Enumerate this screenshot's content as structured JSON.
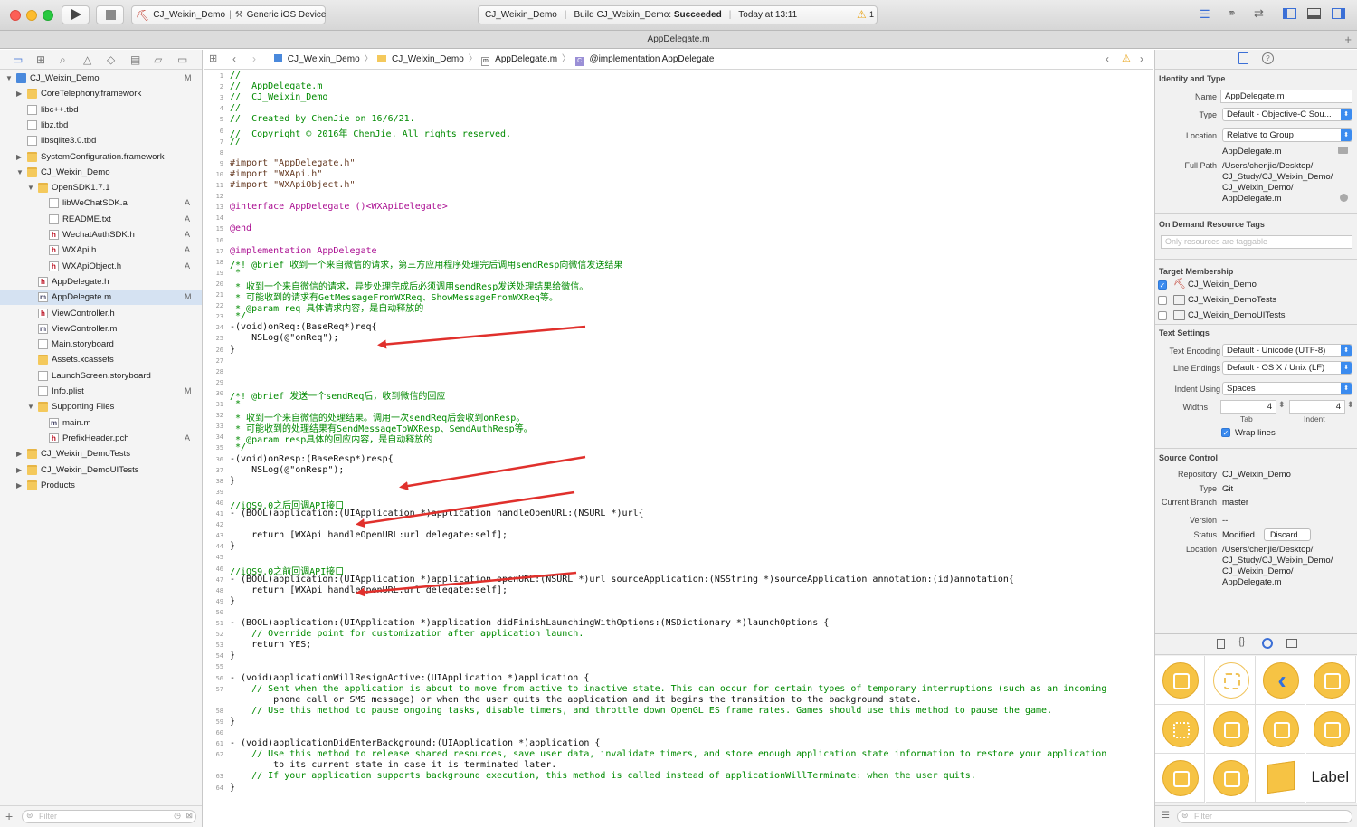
{
  "window": {
    "scheme": "CJ_Weixin_Demo",
    "device": "Generic iOS Device",
    "status_project": "CJ_Weixin_Demo",
    "status_build_prefix": "Build CJ_Weixin_Demo: ",
    "status_build_result": "Succeeded",
    "status_time": "Today at 13:11",
    "warning_count": "1",
    "tab_title": "AppDelegate.m"
  },
  "navigator": {
    "filter_placeholder": "Filter",
    "items": [
      {
        "label": "CJ_Weixin_Demo",
        "badge": "M"
      },
      {
        "label": "CoreTelephony.framework",
        "badge": ""
      },
      {
        "label": "libc++.tbd",
        "badge": ""
      },
      {
        "label": "libz.tbd",
        "badge": ""
      },
      {
        "label": "libsqlite3.0.tbd",
        "badge": ""
      },
      {
        "label": "SystemConfiguration.framework",
        "badge": ""
      },
      {
        "label": "CJ_Weixin_Demo",
        "badge": ""
      },
      {
        "label": "OpenSDK1.7.1",
        "badge": ""
      },
      {
        "label": "libWeChatSDK.a",
        "badge": "A"
      },
      {
        "label": "README.txt",
        "badge": "A"
      },
      {
        "label": "WechatAuthSDK.h",
        "badge": "A"
      },
      {
        "label": "WXApi.h",
        "badge": "A"
      },
      {
        "label": "WXApiObject.h",
        "badge": "A"
      },
      {
        "label": "AppDelegate.h",
        "badge": ""
      },
      {
        "label": "AppDelegate.m",
        "badge": "M"
      },
      {
        "label": "ViewController.h",
        "badge": ""
      },
      {
        "label": "ViewController.m",
        "badge": ""
      },
      {
        "label": "Main.storyboard",
        "badge": ""
      },
      {
        "label": "Assets.xcassets",
        "badge": ""
      },
      {
        "label": "LaunchScreen.storyboard",
        "badge": ""
      },
      {
        "label": "Info.plist",
        "badge": "M"
      },
      {
        "label": "Supporting Files",
        "badge": ""
      },
      {
        "label": "main.m",
        "badge": ""
      },
      {
        "label": "PrefixHeader.pch",
        "badge": "A"
      },
      {
        "label": "CJ_Weixin_DemoTests",
        "badge": ""
      },
      {
        "label": "CJ_Weixin_DemoUITests",
        "badge": ""
      },
      {
        "label": "Products",
        "badge": ""
      }
    ]
  },
  "jumpbar": {
    "crumbs": [
      "CJ_Weixin_Demo",
      "CJ_Weixin_Demo",
      "AppDelegate.m",
      "@implementation AppDelegate"
    ]
  },
  "code": {
    "lines": [
      {
        "n": "1",
        "t": "//"
      },
      {
        "n": "2",
        "t": "//  AppDelegate.m"
      },
      {
        "n": "3",
        "t": "//  CJ_Weixin_Demo"
      },
      {
        "n": "4",
        "t": "//"
      },
      {
        "n": "5",
        "t": "//  Created by ChenJie on 16/6/21."
      },
      {
        "n": "6",
        "t": "//  Copyright © 2016年 ChenJie. All rights reserved."
      },
      {
        "n": "7",
        "t": "//"
      },
      {
        "n": "8",
        "t": ""
      },
      {
        "n": "9",
        "t": "#import \"AppDelegate.h\""
      },
      {
        "n": "10",
        "t": "#import \"WXApi.h\""
      },
      {
        "n": "11",
        "t": "#import \"WXApiObject.h\""
      },
      {
        "n": "12",
        "t": ""
      },
      {
        "n": "13",
        "t": "@interface AppDelegate ()<WXApiDelegate>"
      },
      {
        "n": "14",
        "t": ""
      },
      {
        "n": "15",
        "t": "@end"
      },
      {
        "n": "16",
        "t": ""
      },
      {
        "n": "17",
        "t": "@implementation AppDelegate"
      },
      {
        "n": "18",
        "t": "/*! @brief 收到一个来自微信的请求，第三方应用程序处理完后调用sendResp向微信发送结果"
      },
      {
        "n": "19",
        "t": " *"
      },
      {
        "n": "20",
        "t": " * 收到一个来自微信的请求，异步处理完成后必须调用sendResp发送处理结果给微信。"
      },
      {
        "n": "21",
        "t": " * 可能收到的请求有GetMessageFromWXReq、ShowMessageFromWXReq等。"
      },
      {
        "n": "22",
        "t": " * @param req 具体请求内容，是自动释放的"
      },
      {
        "n": "23",
        "t": " */"
      },
      {
        "n": "24",
        "t": "-(void)onReq:(BaseReq*)req{"
      },
      {
        "n": "25",
        "t": "    NSLog(@\"onReq\");"
      },
      {
        "n": "26",
        "t": "}"
      },
      {
        "n": "27",
        "t": ""
      },
      {
        "n": "28",
        "t": ""
      },
      {
        "n": "29",
        "t": ""
      },
      {
        "n": "30",
        "t": "/*! @brief 发送一个sendReq后，收到微信的回应"
      },
      {
        "n": "31",
        "t": " *"
      },
      {
        "n": "32",
        "t": " * 收到一个来自微信的处理结果。调用一次sendReq后会收到onResp。"
      },
      {
        "n": "33",
        "t": " * 可能收到的处理结果有SendMessageToWXResp、SendAuthResp等。"
      },
      {
        "n": "34",
        "t": " * @param resp具体的回应内容，是自动释放的"
      },
      {
        "n": "35",
        "t": " */"
      },
      {
        "n": "36",
        "t": "-(void)onResp:(BaseResp*)resp{"
      },
      {
        "n": "37",
        "t": "    NSLog(@\"onResp\");"
      },
      {
        "n": "38",
        "t": "}"
      },
      {
        "n": "39",
        "t": ""
      },
      {
        "n": "40",
        "t": "//iOS9.0之后回调API接口"
      },
      {
        "n": "41",
        "t": "- (BOOL)application:(UIApplication *)application handleOpenURL:(NSURL *)url{"
      },
      {
        "n": "42",
        "t": ""
      },
      {
        "n": "43",
        "t": "    return [WXApi handleOpenURL:url delegate:self];"
      },
      {
        "n": "44",
        "t": "}"
      },
      {
        "n": "45",
        "t": ""
      },
      {
        "n": "46",
        "t": "//iOS9.0之前回调API接口"
      },
      {
        "n": "47",
        "t": "- (BOOL)application:(UIApplication *)application openURL:(NSURL *)url sourceApplication:(NSString *)sourceApplication annotation:(id)annotation{"
      },
      {
        "n": "48",
        "t": "    return [WXApi handleOpenURL:url delegate:self];"
      },
      {
        "n": "49",
        "t": "}"
      },
      {
        "n": "50",
        "t": ""
      },
      {
        "n": "51",
        "t": "- (BOOL)application:(UIApplication *)application didFinishLaunchingWithOptions:(NSDictionary *)launchOptions {"
      },
      {
        "n": "52",
        "t": "    // Override point for customization after application launch."
      },
      {
        "n": "53",
        "t": "    return YES;"
      },
      {
        "n": "54",
        "t": "}"
      },
      {
        "n": "55",
        "t": ""
      },
      {
        "n": "56",
        "t": "- (void)applicationWillResignActive:(UIApplication *)application {"
      },
      {
        "n": "57",
        "t": "    // Sent when the application is about to move from active to inactive state. This can occur for certain types of temporary interruptions (such as an incoming"
      },
      {
        "n": "",
        "t": "        phone call or SMS message) or when the user quits the application and it begins the transition to the background state."
      },
      {
        "n": "58",
        "t": "    // Use this method to pause ongoing tasks, disable timers, and throttle down OpenGL ES frame rates. Games should use this method to pause the game."
      },
      {
        "n": "59",
        "t": "}"
      },
      {
        "n": "60",
        "t": ""
      },
      {
        "n": "61",
        "t": "- (void)applicationDidEnterBackground:(UIApplication *)application {"
      },
      {
        "n": "62",
        "t": "    // Use this method to release shared resources, save user data, invalidate timers, and store enough application state information to restore your application"
      },
      {
        "n": "",
        "t": "        to its current state in case it is terminated later."
      },
      {
        "n": "63",
        "t": "    // If your application supports background execution, this method is called instead of applicationWillTerminate: when the user quits."
      },
      {
        "n": "64",
        "t": "}"
      }
    ]
  },
  "inspector": {
    "identity_title": "Identity and Type",
    "name_label": "Name",
    "name_value": "AppDelegate.m",
    "type_label": "Type",
    "type_value": "Default - Objective-C Sou...",
    "location_label": "Location",
    "location_value": "Relative to Group",
    "location_file": "AppDelegate.m",
    "fullpath_label": "Full Path",
    "fullpath_lines": [
      "/Users/chenjie/Desktop/",
      "CJ_Study/CJ_Weixin_Demo/",
      "CJ_Weixin_Demo/",
      "AppDelegate.m"
    ],
    "ondemand_title": "On Demand Resource Tags",
    "ondemand_placeholder": "Only resources are taggable",
    "target_title": "Target Membership",
    "targets": [
      {
        "label": "CJ_Weixin_Demo",
        "checked": true
      },
      {
        "label": "CJ_Weixin_DemoTests",
        "checked": false
      },
      {
        "label": "CJ_Weixin_DemoUITests",
        "checked": false
      }
    ],
    "text_title": "Text Settings",
    "encoding_label": "Text Encoding",
    "encoding_value": "Default - Unicode (UTF-8)",
    "endings_label": "Line Endings",
    "endings_value": "Default - OS X / Unix (LF)",
    "indent_label": "Indent Using",
    "indent_value": "Spaces",
    "widths_label": "Widths",
    "tab_width": "4",
    "indent_width": "4",
    "tab_caption": "Tab",
    "indent_caption": "Indent",
    "wrap_label": "Wrap lines",
    "source_title": "Source Control",
    "repo_label": "Repository",
    "repo_value": "CJ_Weixin_Demo",
    "sc_type_label": "Type",
    "sc_type_value": "Git",
    "branch_label": "Current Branch",
    "branch_value": "master",
    "version_label": "Version",
    "version_value": "--",
    "status_label": "Status",
    "status_value": "Modified",
    "discard_label": "Discard...",
    "sc_location_label": "Location",
    "sc_location_lines": [
      "/Users/chenjie/Desktop/",
      "CJ_Study/CJ_Weixin_Demo/",
      "CJ_Weixin_Demo/",
      "AppDelegate.m"
    ],
    "library_label_item": "Label",
    "library_filter_placeholder": "Filter"
  },
  "colors": {
    "accent": "#3b8bef",
    "arrow": "#e0302c",
    "library_icon": "#f6c344"
  }
}
